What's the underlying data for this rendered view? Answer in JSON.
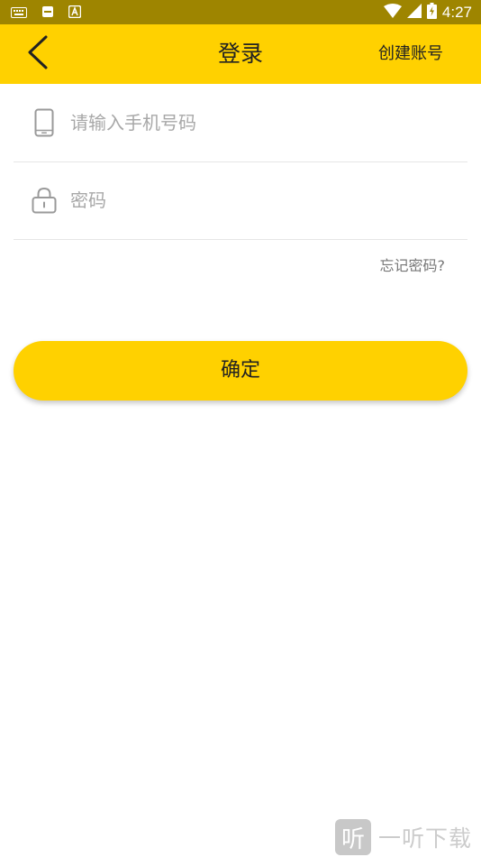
{
  "status_bar": {
    "time": "4:27",
    "icons": [
      "keyboard-icon",
      "sd-card-icon",
      "a-badge-icon",
      "wifi-icon",
      "cell-signal-icon",
      "battery-charging-icon"
    ]
  },
  "app_bar": {
    "title": "登录",
    "action_label": "创建账号",
    "back_icon": "chevron-left-icon"
  },
  "form": {
    "phone": {
      "icon": "phone-icon",
      "value": "",
      "placeholder": "请输入手机号码"
    },
    "password": {
      "icon": "lock-icon",
      "value": "",
      "placeholder": "密码"
    },
    "forgot_label": "忘记密码?",
    "submit_label": "确定"
  },
  "watermark": {
    "logo_char": "听",
    "text": "一听下载"
  },
  "colors": {
    "accent": "#ffd100",
    "status_bar": "#9e8500",
    "placeholder": "#a8a8a8",
    "divider": "#e6e6e6"
  }
}
